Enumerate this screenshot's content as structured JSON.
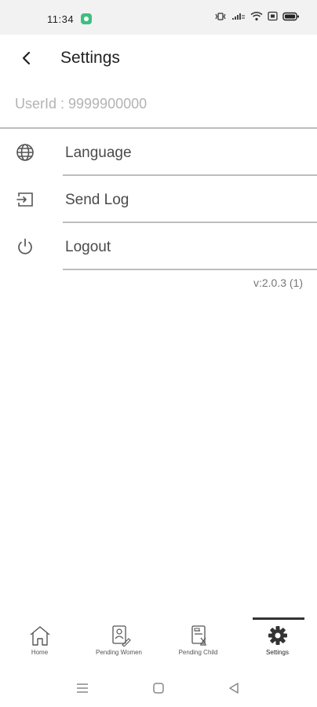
{
  "status_bar": {
    "time": "11:34"
  },
  "header": {
    "title": "Settings"
  },
  "user": {
    "userid_text": "UserId : 9999900000"
  },
  "menu": {
    "items": [
      {
        "icon": "globe-icon",
        "label": "Language"
      },
      {
        "icon": "send-log-icon",
        "label": "Send Log"
      },
      {
        "icon": "power-icon",
        "label": "Logout"
      }
    ]
  },
  "version": "v:2.0.3 (1)",
  "bottom_nav": {
    "items": [
      {
        "icon": "home-icon",
        "label": "Home"
      },
      {
        "icon": "pending-women-icon",
        "label": "Pending Women"
      },
      {
        "icon": "pending-child-icon",
        "label": "Pending Child"
      },
      {
        "icon": "settings-gear-icon",
        "label": "Settings",
        "active": true
      }
    ]
  },
  "colors": {
    "status_bar_bg": "#f2f2f2",
    "divider": "#bdbdbd",
    "userid_text": "#b3b3b3",
    "app_badge": "#3fbf7f"
  }
}
